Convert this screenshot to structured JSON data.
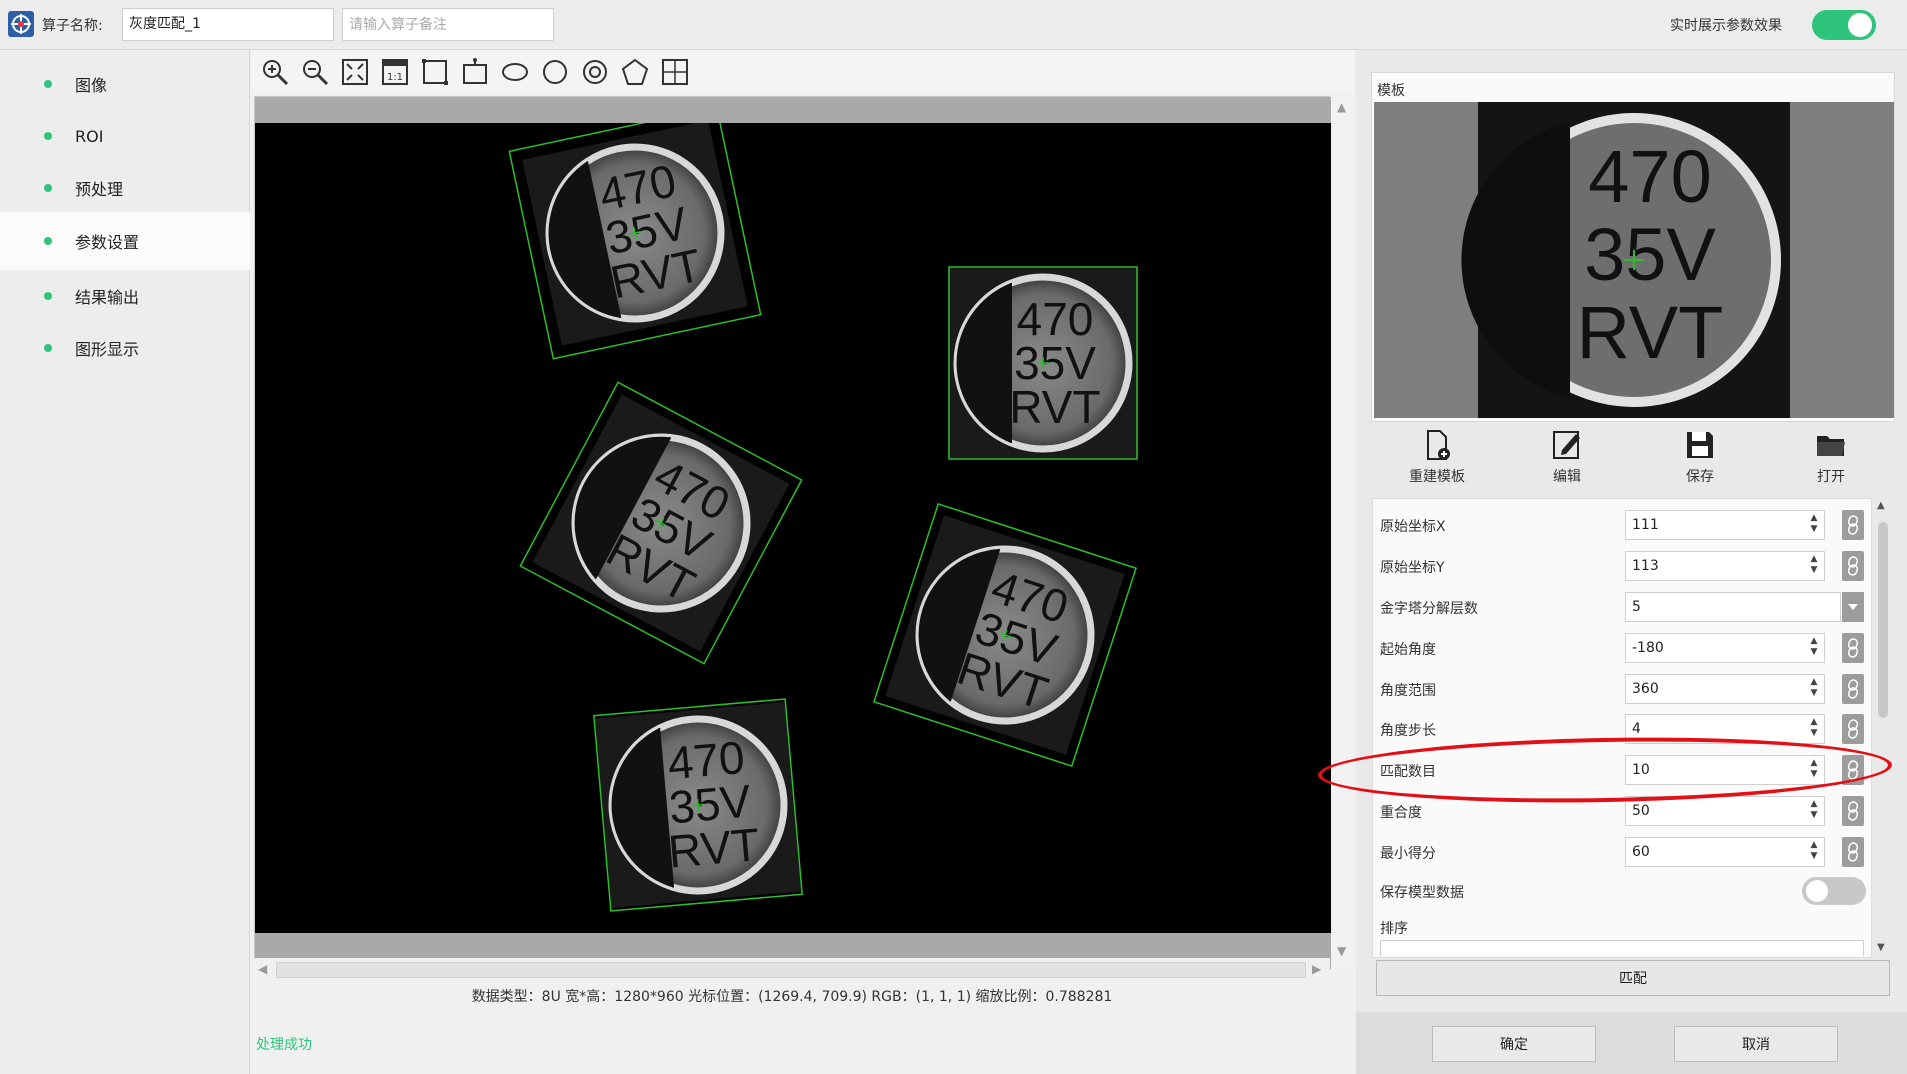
{
  "topbar": {
    "name_label": "算子名称:",
    "name_value": "灰度匹配_1",
    "remark_placeholder": "请输入算子备注",
    "realtime_label": "实时展示参数效果",
    "realtime_enabled": true
  },
  "sidebar": {
    "items": [
      {
        "label": "图像",
        "active": false
      },
      {
        "label": "ROI",
        "active": false
      },
      {
        "label": "预处理",
        "active": false
      },
      {
        "label": "参数设置",
        "active": true
      },
      {
        "label": "结果输出",
        "active": false
      },
      {
        "label": "图形显示",
        "active": false
      }
    ]
  },
  "toolbar": {
    "tools": [
      "zoom-in-icon",
      "zoom-out-icon",
      "fit-screen-icon",
      "actual-size-icon",
      "rectangle-icon",
      "rotated-rectangle-icon",
      "ellipse-icon",
      "circle-icon",
      "ring-icon",
      "polygon-icon",
      "grid-icon"
    ]
  },
  "capacitor": {
    "line1": "470",
    "line2": "35V",
    "line3": "RVT"
  },
  "status": {
    "info": "数据类型：8U 宽*高：1280*960 光标位置：(1269.4, 709.9) RGB：(1, 1, 1) 缩放比例：0.788281",
    "message": "处理成功"
  },
  "template": {
    "label": "模板",
    "actions": [
      {
        "label": "重建模板",
        "icon": "new-template-icon"
      },
      {
        "label": "编辑",
        "icon": "edit-icon"
      },
      {
        "label": "保存",
        "icon": "save-icon"
      },
      {
        "label": "打开",
        "icon": "open-folder-icon"
      }
    ]
  },
  "params": [
    {
      "label": "原始坐标X",
      "value": "111",
      "control": "spin"
    },
    {
      "label": "原始坐标Y",
      "value": "113",
      "control": "spin"
    },
    {
      "label": "金字塔分解层数",
      "value": "5",
      "control": "dropdown"
    },
    {
      "label": "起始角度",
      "value": "-180",
      "control": "spin"
    },
    {
      "label": "角度范围",
      "value": "360",
      "control": "spin"
    },
    {
      "label": "角度步长",
      "value": "4",
      "control": "spin"
    },
    {
      "label": "匹配数目",
      "value": "10",
      "control": "spin",
      "highlighted": true
    },
    {
      "label": "重合度",
      "value": "50",
      "control": "spin"
    },
    {
      "label": "最小得分",
      "value": "60",
      "control": "spin"
    },
    {
      "label": "保存模型数据",
      "value": "",
      "control": "toggle",
      "enabled": false
    },
    {
      "label": "排序",
      "value": "",
      "control": "dropdown"
    }
  ],
  "buttons": {
    "match": "匹配",
    "confirm": "确定",
    "cancel": "取消"
  },
  "colors": {
    "accent": "#2fc47c",
    "detection_box": "#2bbf2b",
    "highlight": "#e30f16"
  }
}
